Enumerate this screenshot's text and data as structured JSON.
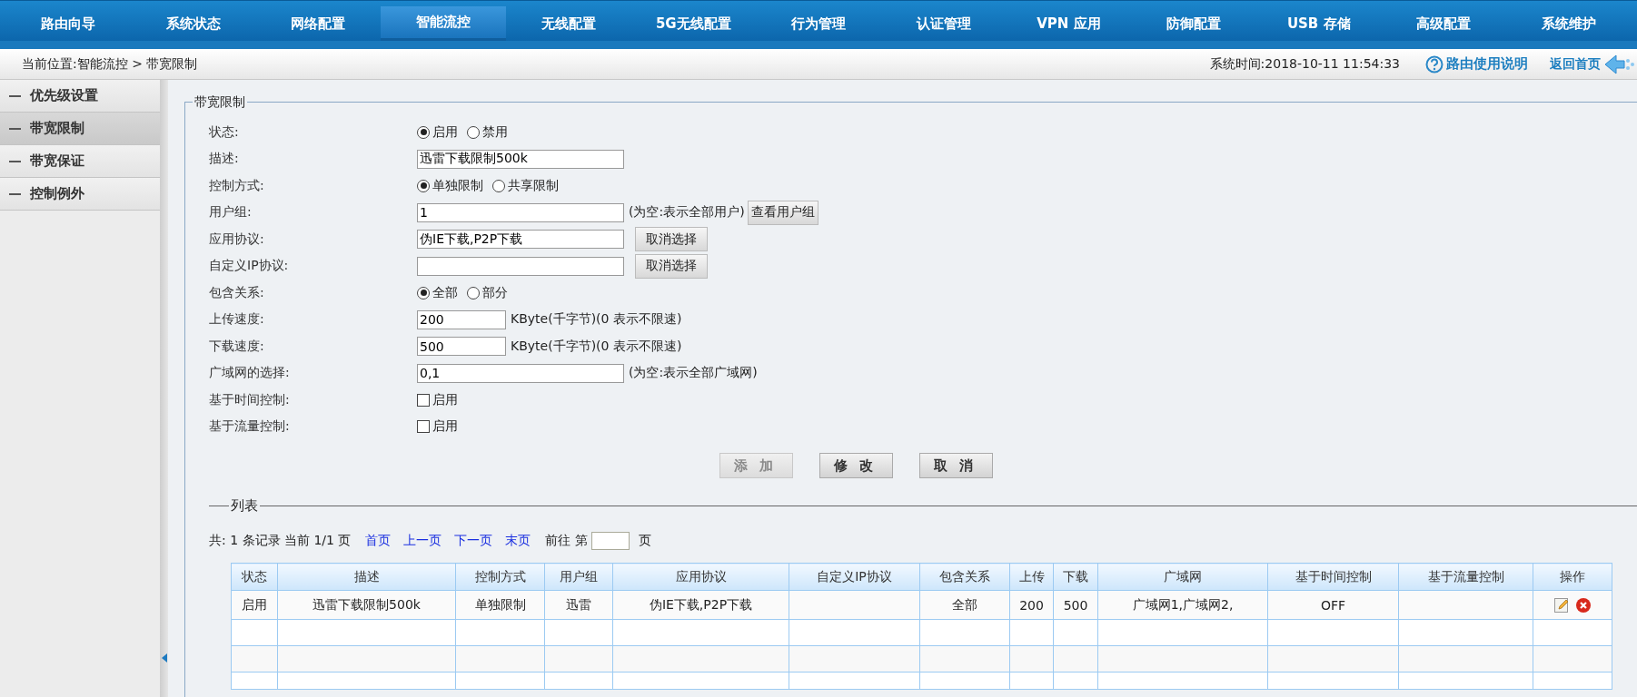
{
  "nav": [
    {
      "label": "路由向导",
      "selected": false
    },
    {
      "label": "系统状态",
      "selected": false
    },
    {
      "label": "网络配置",
      "selected": false
    },
    {
      "label": "智能流控",
      "selected": true
    },
    {
      "label": "无线配置",
      "selected": false
    },
    {
      "label": "5G无线配置",
      "selected": false
    },
    {
      "label": "行为管理",
      "selected": false
    },
    {
      "label": "认证管理",
      "selected": false
    },
    {
      "label": "VPN 应用",
      "selected": false
    },
    {
      "label": "防御配置",
      "selected": false
    },
    {
      "label": "USB 存储",
      "selected": false
    },
    {
      "label": "高级配置",
      "selected": false
    },
    {
      "label": "系统维护",
      "selected": false
    }
  ],
  "breadcrumb": "当前位置:智能流控 > 带宽限制",
  "system_time": "系统时间:2018-10-11 11:54:33",
  "help_link": "路由使用说明",
  "home_link": "返回首页",
  "sidebar": {
    "items": [
      {
        "label": "优先级设置",
        "selected": false
      },
      {
        "label": "带宽限制",
        "selected": true
      },
      {
        "label": "带宽保证",
        "selected": false
      },
      {
        "label": "控制例外",
        "selected": false
      }
    ]
  },
  "form": {
    "legend": "带宽限制",
    "rows": [
      {
        "label": "状态:",
        "kind": "radio",
        "options": [
          {
            "label": "启用",
            "selected": true
          },
          {
            "label": "禁用",
            "selected": false
          }
        ]
      },
      {
        "label": "描述:",
        "kind": "input",
        "value": "迅雷下载限制500k"
      },
      {
        "label": "控制方式:",
        "kind": "radio",
        "options": [
          {
            "label": "单独限制",
            "selected": true
          },
          {
            "label": "共享限制",
            "selected": false
          }
        ]
      },
      {
        "label": "用户组:",
        "kind": "input",
        "value": "1",
        "note": "(为空:表示全部用户)",
        "button": "查看用户组"
      },
      {
        "label": "应用协议:",
        "kind": "input",
        "value": "伪IE下载,P2P下载",
        "button": "取消选择"
      },
      {
        "label": "自定义IP协议:",
        "kind": "input",
        "value": "",
        "button": "取消选择"
      },
      {
        "label": "包含关系:",
        "kind": "radio",
        "options": [
          {
            "label": "全部",
            "selected": true
          },
          {
            "label": "部分",
            "selected": false
          }
        ]
      },
      {
        "label": "上传速度:",
        "kind": "short_input",
        "value": "200",
        "note": "KByte(千字节)(0 表示不限速)"
      },
      {
        "label": "下载速度:",
        "kind": "short_input",
        "value": "500",
        "note": "KByte(千字节)(0 表示不限速)"
      },
      {
        "label": "广域网的选择:",
        "kind": "input",
        "value": "0,1",
        "note": "(为空:表示全部广域网)"
      },
      {
        "label": "基于时间控制:",
        "kind": "checkbox",
        "option": {
          "label": "启用",
          "checked": false
        }
      },
      {
        "label": "基于流量控制:",
        "kind": "checkbox",
        "option": {
          "label": "启用",
          "checked": false
        }
      }
    ]
  },
  "buttons": [
    {
      "label": "添加",
      "disabled": true
    },
    {
      "label": "修改",
      "disabled": false
    },
    {
      "label": "取消",
      "disabled": false
    }
  ],
  "list": {
    "legend": "列表",
    "summary": "共: 1 条记录 当前 1/1 页",
    "links": [
      "首页",
      "上一页",
      "下一页",
      "末页"
    ],
    "goto_prefix": "前往 第",
    "goto_suffix": "页",
    "table": {
      "columns": [
        "状态",
        "描述",
        "控制方式",
        "用户组",
        "应用协议",
        "自定义IP协议",
        "包含关系",
        "上传",
        "下载",
        "广域网",
        "基于时间控制",
        "基于流量控制",
        "操作"
      ],
      "rows": [
        {
          "cells": [
            "启用",
            "迅雷下载限制500k",
            "单独限制",
            "迅雷",
            "伪IE下载,P2P下载",
            "",
            "全部",
            "200",
            "500",
            "广域网1,广域网2,",
            "OFF",
            ""
          ]
        }
      ]
    }
  }
}
